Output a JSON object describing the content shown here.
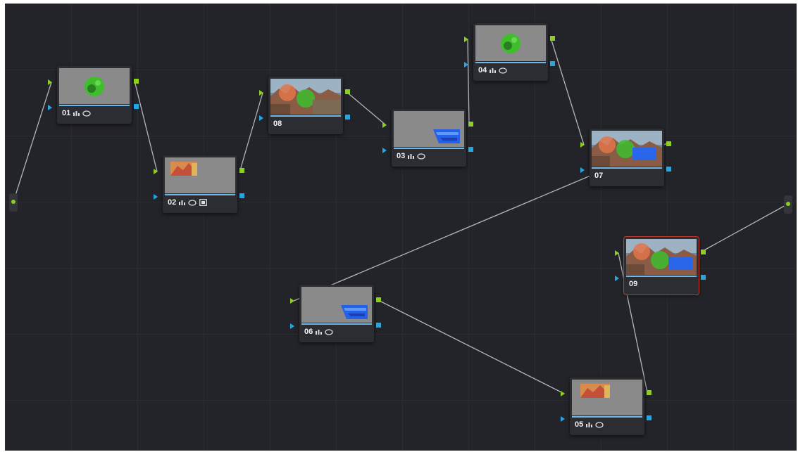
{
  "colors": {
    "background": "#232429",
    "node_body": "#2c2d32",
    "thumb_gray": "#8a8a8a",
    "rgb_connector": "#8ccf1f",
    "alpha_connector": "#24a6e3",
    "wire": "#b5b5b5",
    "selected_outline": "#c0392b"
  },
  "nodes": [
    {
      "id": "01",
      "label": "01",
      "icons": [
        "bars-icon",
        "window-icon"
      ],
      "thumb": "green-circle",
      "selected": false
    },
    {
      "id": "02",
      "label": "02",
      "icons": [
        "bars-icon",
        "window-icon",
        "key-icon"
      ],
      "thumb": "warm-corner",
      "selected": false
    },
    {
      "id": "08",
      "label": "08",
      "icons": [],
      "thumb": "full-image-green",
      "selected": false
    },
    {
      "id": "03",
      "label": "03",
      "icons": [
        "bars-icon",
        "window-icon"
      ],
      "thumb": "blue-water",
      "selected": false
    },
    {
      "id": "04",
      "label": "04",
      "icons": [
        "bars-icon",
        "window-icon"
      ],
      "thumb": "green-circle",
      "selected": false
    },
    {
      "id": "07",
      "label": "07",
      "icons": [],
      "thumb": "full-image-green-blue",
      "selected": false
    },
    {
      "id": "09",
      "label": "09",
      "icons": [],
      "thumb": "full-image-green-blue",
      "selected": true
    },
    {
      "id": "06",
      "label": "06",
      "icons": [
        "bars-icon",
        "window-icon"
      ],
      "thumb": "blue-water",
      "selected": false
    },
    {
      "id": "05",
      "label": "05",
      "icons": [
        "bars-icon",
        "window-icon"
      ],
      "thumb": "warm-corner",
      "selected": false
    }
  ],
  "connections": [
    [
      "source",
      "01"
    ],
    [
      "01",
      "02"
    ],
    [
      "02",
      "08"
    ],
    [
      "08",
      "03"
    ],
    [
      "03",
      "04"
    ],
    [
      "04",
      "07"
    ],
    [
      "07",
      "06"
    ],
    [
      "06",
      "05"
    ],
    [
      "05",
      "09"
    ],
    [
      "09",
      "output"
    ]
  ]
}
